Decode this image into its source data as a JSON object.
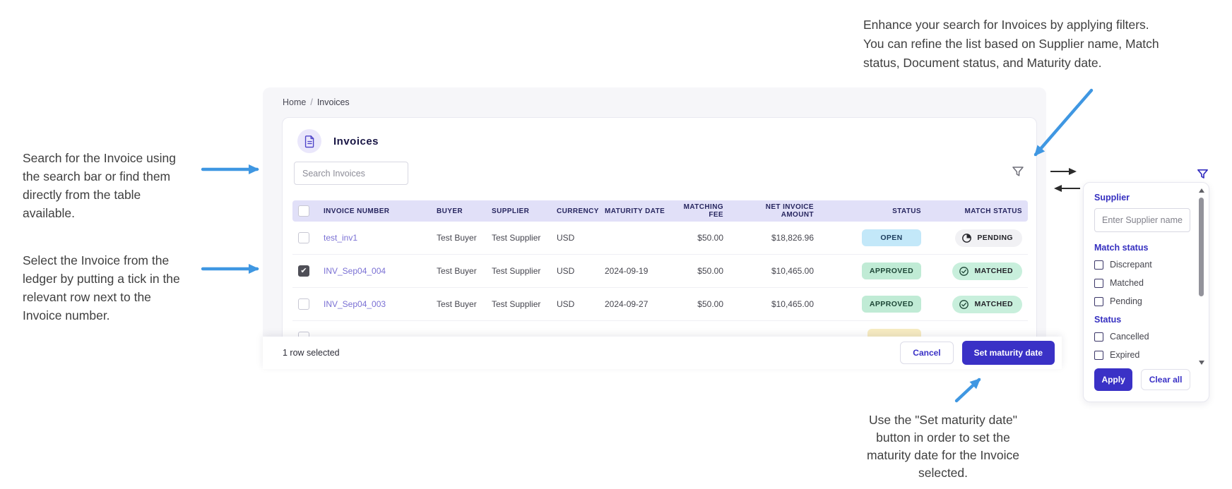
{
  "annotations": {
    "top_right": [
      "Enhance your search for Invoices by applying filters.",
      "You can refine the list based on Supplier name, Match",
      "status, Document status, and Maturity date."
    ],
    "left_search": [
      "Search for the Invoice using",
      "the search bar or find them",
      "directly from the table",
      "available."
    ],
    "left_select": [
      "Select the Invoice from the",
      "ledger by putting a tick in the",
      "relevant row next to the",
      "Invoice number."
    ],
    "bottom": [
      "Use the \"Set maturity date\"",
      "button in order to set the",
      "maturity date for the Invoice",
      "selected."
    ]
  },
  "breadcrumb": {
    "home": "Home",
    "separator": "/",
    "current": "Invoices"
  },
  "card": {
    "title": "Invoices",
    "search_placeholder": "Search Invoices"
  },
  "table": {
    "columns": [
      {
        "label": "INVOICE NUMBER",
        "align": "left"
      },
      {
        "label": "BUYER",
        "align": "left"
      },
      {
        "label": "SUPPLIER",
        "align": "left"
      },
      {
        "label": "CURRENCY",
        "align": "left"
      },
      {
        "label": "MATURITY DATE",
        "align": "left"
      },
      {
        "label": "MATCHING FEE",
        "align": "right"
      },
      {
        "label": "NET INVOICE AMOUNT",
        "align": "right"
      },
      {
        "label": "STATUS",
        "align": "right"
      },
      {
        "label": "MATCH STATUS",
        "align": "right"
      }
    ],
    "rows": [
      {
        "checked": false,
        "invoice_number": "test_inv1",
        "buyer": "Test Buyer",
        "supplier": "Test Supplier",
        "currency": "USD",
        "maturity_date": "",
        "matching_fee": "$50.00",
        "net_invoice_amount": "$18,826.96",
        "status": "OPEN",
        "match_status": "PENDING"
      },
      {
        "checked": true,
        "invoice_number": "INV_Sep04_004",
        "buyer": "Test Buyer",
        "supplier": "Test Supplier",
        "currency": "USD",
        "maturity_date": "2024-09-19",
        "matching_fee": "$50.00",
        "net_invoice_amount": "$10,465.00",
        "status": "APPROVED",
        "match_status": "MATCHED"
      },
      {
        "checked": false,
        "invoice_number": "INV_Sep04_003",
        "buyer": "Test Buyer",
        "supplier": "Test Supplier",
        "currency": "USD",
        "maturity_date": "2024-09-27",
        "matching_fee": "$50.00",
        "net_invoice_amount": "$10,465.00",
        "status": "APPROVED",
        "match_status": "MATCHED"
      }
    ],
    "partial_row": {
      "visible": true,
      "badge_color": "#f7ecc2"
    }
  },
  "footer": {
    "selected_text": "1 row selected",
    "cancel_label": "Cancel",
    "primary_label": "Set maturity date"
  },
  "filter_panel": {
    "supplier_label": "Supplier",
    "supplier_placeholder": "Enter Supplier name",
    "match_status_label": "Match status",
    "match_status_options": [
      "Discrepant",
      "Matched",
      "Pending"
    ],
    "status_label": "Status",
    "status_options": [
      "Cancelled",
      "Expired"
    ],
    "apply_label": "Apply",
    "clear_label": "Clear all"
  },
  "colors": {
    "primary": "#3a31c6",
    "invoice_link": "#7a70d4",
    "table_header_bg": "#e1e0f8",
    "status_open_bg": "#c3e8f9",
    "status_approved_bg": "#c0ebd5",
    "match_pending_bg": "#f1f1f4",
    "match_matched_bg": "#c8efdc",
    "partial_row_badge_bg": "#f7ecc2",
    "annotation_arrow_blue": "#3f97e2",
    "swap_arrow_black": "#2b2b2b",
    "checked_checkbox": "#4f4f57"
  }
}
